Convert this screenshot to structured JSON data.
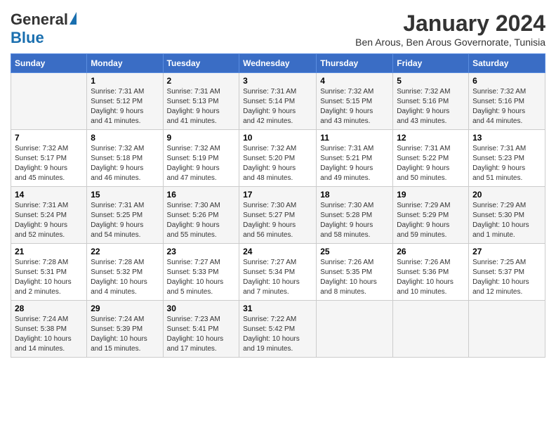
{
  "header": {
    "logo_line1": "General",
    "logo_line2": "Blue",
    "month_title": "January 2024",
    "subtitle": "Ben Arous, Ben Arous Governorate, Tunisia"
  },
  "weekdays": [
    "Sunday",
    "Monday",
    "Tuesday",
    "Wednesday",
    "Thursday",
    "Friday",
    "Saturday"
  ],
  "weeks": [
    [
      {
        "day": "",
        "info": ""
      },
      {
        "day": "1",
        "info": "Sunrise: 7:31 AM\nSunset: 5:12 PM\nDaylight: 9 hours\nand 41 minutes."
      },
      {
        "day": "2",
        "info": "Sunrise: 7:31 AM\nSunset: 5:13 PM\nDaylight: 9 hours\nand 41 minutes."
      },
      {
        "day": "3",
        "info": "Sunrise: 7:31 AM\nSunset: 5:14 PM\nDaylight: 9 hours\nand 42 minutes."
      },
      {
        "day": "4",
        "info": "Sunrise: 7:32 AM\nSunset: 5:15 PM\nDaylight: 9 hours\nand 43 minutes."
      },
      {
        "day": "5",
        "info": "Sunrise: 7:32 AM\nSunset: 5:16 PM\nDaylight: 9 hours\nand 43 minutes."
      },
      {
        "day": "6",
        "info": "Sunrise: 7:32 AM\nSunset: 5:16 PM\nDaylight: 9 hours\nand 44 minutes."
      }
    ],
    [
      {
        "day": "7",
        "info": "Sunrise: 7:32 AM\nSunset: 5:17 PM\nDaylight: 9 hours\nand 45 minutes."
      },
      {
        "day": "8",
        "info": "Sunrise: 7:32 AM\nSunset: 5:18 PM\nDaylight: 9 hours\nand 46 minutes."
      },
      {
        "day": "9",
        "info": "Sunrise: 7:32 AM\nSunset: 5:19 PM\nDaylight: 9 hours\nand 47 minutes."
      },
      {
        "day": "10",
        "info": "Sunrise: 7:32 AM\nSunset: 5:20 PM\nDaylight: 9 hours\nand 48 minutes."
      },
      {
        "day": "11",
        "info": "Sunrise: 7:31 AM\nSunset: 5:21 PM\nDaylight: 9 hours\nand 49 minutes."
      },
      {
        "day": "12",
        "info": "Sunrise: 7:31 AM\nSunset: 5:22 PM\nDaylight: 9 hours\nand 50 minutes."
      },
      {
        "day": "13",
        "info": "Sunrise: 7:31 AM\nSunset: 5:23 PM\nDaylight: 9 hours\nand 51 minutes."
      }
    ],
    [
      {
        "day": "14",
        "info": "Sunrise: 7:31 AM\nSunset: 5:24 PM\nDaylight: 9 hours\nand 52 minutes."
      },
      {
        "day": "15",
        "info": "Sunrise: 7:31 AM\nSunset: 5:25 PM\nDaylight: 9 hours\nand 54 minutes."
      },
      {
        "day": "16",
        "info": "Sunrise: 7:30 AM\nSunset: 5:26 PM\nDaylight: 9 hours\nand 55 minutes."
      },
      {
        "day": "17",
        "info": "Sunrise: 7:30 AM\nSunset: 5:27 PM\nDaylight: 9 hours\nand 56 minutes."
      },
      {
        "day": "18",
        "info": "Sunrise: 7:30 AM\nSunset: 5:28 PM\nDaylight: 9 hours\nand 58 minutes."
      },
      {
        "day": "19",
        "info": "Sunrise: 7:29 AM\nSunset: 5:29 PM\nDaylight: 9 hours\nand 59 minutes."
      },
      {
        "day": "20",
        "info": "Sunrise: 7:29 AM\nSunset: 5:30 PM\nDaylight: 10 hours\nand 1 minute."
      }
    ],
    [
      {
        "day": "21",
        "info": "Sunrise: 7:28 AM\nSunset: 5:31 PM\nDaylight: 10 hours\nand 2 minutes."
      },
      {
        "day": "22",
        "info": "Sunrise: 7:28 AM\nSunset: 5:32 PM\nDaylight: 10 hours\nand 4 minutes."
      },
      {
        "day": "23",
        "info": "Sunrise: 7:27 AM\nSunset: 5:33 PM\nDaylight: 10 hours\nand 5 minutes."
      },
      {
        "day": "24",
        "info": "Sunrise: 7:27 AM\nSunset: 5:34 PM\nDaylight: 10 hours\nand 7 minutes."
      },
      {
        "day": "25",
        "info": "Sunrise: 7:26 AM\nSunset: 5:35 PM\nDaylight: 10 hours\nand 8 minutes."
      },
      {
        "day": "26",
        "info": "Sunrise: 7:26 AM\nSunset: 5:36 PM\nDaylight: 10 hours\nand 10 minutes."
      },
      {
        "day": "27",
        "info": "Sunrise: 7:25 AM\nSunset: 5:37 PM\nDaylight: 10 hours\nand 12 minutes."
      }
    ],
    [
      {
        "day": "28",
        "info": "Sunrise: 7:24 AM\nSunset: 5:38 PM\nDaylight: 10 hours\nand 14 minutes."
      },
      {
        "day": "29",
        "info": "Sunrise: 7:24 AM\nSunset: 5:39 PM\nDaylight: 10 hours\nand 15 minutes."
      },
      {
        "day": "30",
        "info": "Sunrise: 7:23 AM\nSunset: 5:41 PM\nDaylight: 10 hours\nand 17 minutes."
      },
      {
        "day": "31",
        "info": "Sunrise: 7:22 AM\nSunset: 5:42 PM\nDaylight: 10 hours\nand 19 minutes."
      },
      {
        "day": "",
        "info": ""
      },
      {
        "day": "",
        "info": ""
      },
      {
        "day": "",
        "info": ""
      }
    ]
  ]
}
